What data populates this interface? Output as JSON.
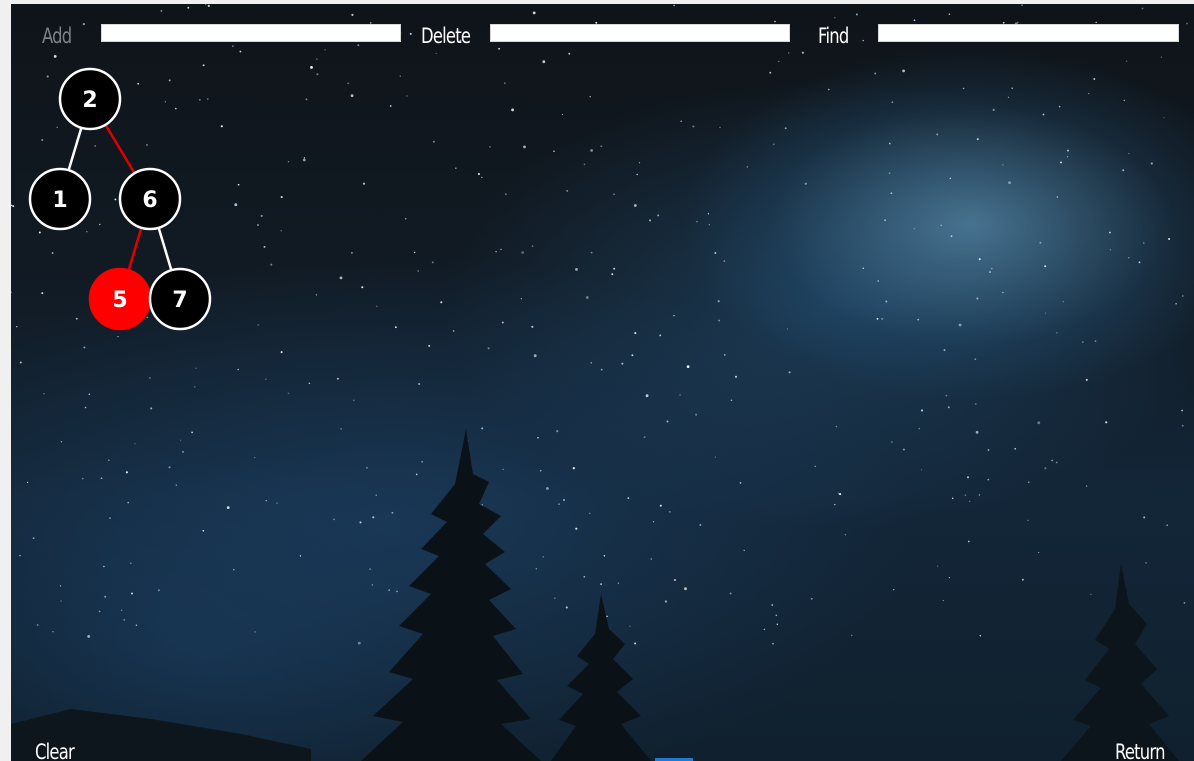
{
  "toolbar": {
    "add_label": "Add",
    "add_value": "",
    "delete_label": "Delete",
    "delete_value": "",
    "find_label": "Find",
    "find_value": ""
  },
  "tree": {
    "nodes": [
      {
        "key": "2",
        "color": "black"
      },
      {
        "key": "1",
        "color": "black"
      },
      {
        "key": "6",
        "color": "black"
      },
      {
        "key": "5",
        "color": "red"
      },
      {
        "key": "7",
        "color": "black"
      }
    ],
    "edges": [
      {
        "from": "2",
        "to": "1",
        "color": "black"
      },
      {
        "from": "2",
        "to": "6",
        "color": "red"
      },
      {
        "from": "6",
        "to": "5",
        "color": "red"
      },
      {
        "from": "6",
        "to": "7",
        "color": "black"
      }
    ],
    "colors": {
      "black_node_fill": "#000000",
      "red_node_fill": "#ff0000",
      "node_stroke": "#ffffff",
      "black_edge": "#ffffff",
      "red_edge": "#e00000"
    }
  },
  "footer": {
    "clear_label": "Clear",
    "return_label": "Return"
  }
}
